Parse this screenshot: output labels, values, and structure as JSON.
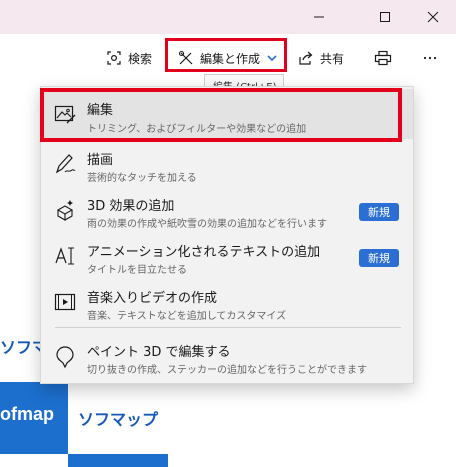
{
  "window": {
    "minimize_icon": "minimize-icon",
    "maximize_icon": "maximize-icon",
    "close_icon": "close-icon"
  },
  "toolbar": {
    "search_label": "検索",
    "edit_create_label": "編集と作成",
    "share_label": "共有",
    "tooltip": "編集 (Ctrl+E)"
  },
  "menu": {
    "items": [
      {
        "title": "編集",
        "subtitle": "トリミング、およびフィルターや効果などの追加",
        "icon": "image-edit-icon"
      },
      {
        "title": "描画",
        "subtitle": "芸術的なタッチを加える",
        "icon": "draw-icon"
      },
      {
        "title": "3D 効果の追加",
        "subtitle": "雨の効果の作成や紙吹雪の効果の追加などを行います",
        "icon": "sparkle-3d-icon",
        "badge": "新規"
      },
      {
        "title": "アニメーション化されるテキストの追加",
        "subtitle": "タイトルを目立たせる",
        "icon": "animated-text-icon",
        "badge": "新規"
      },
      {
        "title": "音楽入りビデオの作成",
        "subtitle": "音楽、テキストなどを追加してカスタマイズ",
        "icon": "video-icon"
      },
      {
        "title": "ペイント 3D で編集する",
        "subtitle": "切り抜きの作成、ステッカーの追加などを行うことができます",
        "icon": "paint3d-icon"
      }
    ]
  },
  "background": {
    "brand_text_partial": "ソフマッ",
    "logo_text": "ofmap",
    "logo_name": "ソフマップ"
  },
  "colors": {
    "highlight": "#e3001b",
    "accent": "#2b6fd4",
    "brand": "#1d6fce"
  }
}
